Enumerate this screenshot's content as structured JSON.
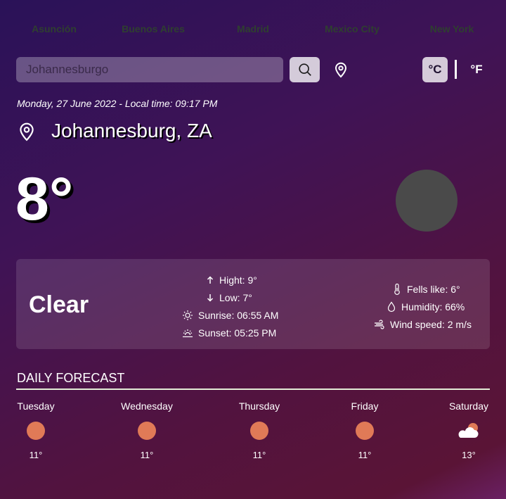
{
  "cities": [
    "Asunción",
    "Buenos Aires",
    "Madrid",
    "Mexico City",
    "New York"
  ],
  "search": {
    "value": "Johannesburgo",
    "placeholder": ""
  },
  "units": {
    "celsius": "°C",
    "fahrenheit": "°F",
    "active": "celsius"
  },
  "datetime": "Monday, 27 June 2022 - Local time: 09:17 PM",
  "location": "Johannesburg, ZA",
  "current": {
    "temperature": "8°",
    "condition": "Clear",
    "high": "Hight: 9°",
    "low": "Low: 7°",
    "sunrise": "Sunrise: 06:55 AM",
    "sunset": "Sunset: 05:25 PM",
    "feels_like": "Fells like: 6°",
    "humidity": "Humidity: 66%",
    "wind": "Wind speed: 2 m/s"
  },
  "forecast": {
    "title": "DAILY FORECAST",
    "days": [
      {
        "day": "Tuesday",
        "temp": "11°",
        "icon": "sun-icon"
      },
      {
        "day": "Wednesday",
        "temp": "11°",
        "icon": "sun-icon"
      },
      {
        "day": "Thursday",
        "temp": "11°",
        "icon": "sun-icon"
      },
      {
        "day": "Friday",
        "temp": "11°",
        "icon": "sun-icon"
      },
      {
        "day": "Saturday",
        "temp": "13°",
        "icon": "partly-cloudy-icon"
      }
    ]
  },
  "colors": {
    "sun": "#e07a57",
    "icon_placeholder": "#4a4a4a",
    "city_links": "#2f3f30"
  }
}
